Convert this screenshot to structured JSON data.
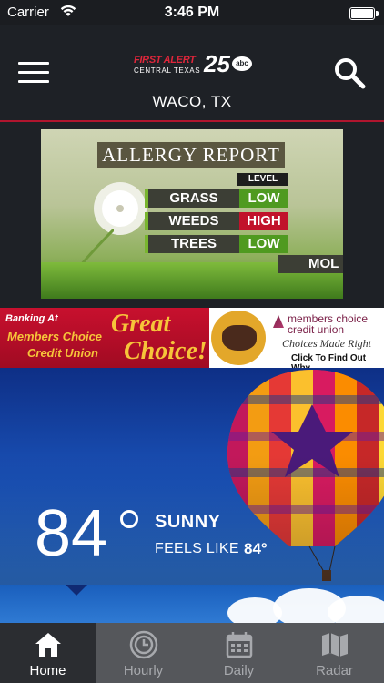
{
  "status_bar": {
    "carrier": "Carrier",
    "time": "3:46 PM"
  },
  "header": {
    "logo": {
      "line1": "FIRST ALERT",
      "line2": "CENTRAL TEXAS",
      "channel": "25",
      "network": "abc"
    },
    "location": "WACO, TX",
    "accent_color": "#b0152e"
  },
  "allergy_report": {
    "title": "ALLERGY REPORT",
    "level_header": "LEVEL",
    "rows": [
      {
        "name": "GRASS",
        "level": "LOW",
        "level_color": "#4f9a20"
      },
      {
        "name": "WEEDS",
        "level": "HIGH",
        "level_color": "#c1122b"
      },
      {
        "name": "TREES",
        "level": "LOW",
        "level_color": "#4f9a20"
      }
    ],
    "partial": "MOL"
  },
  "ad": {
    "line1": "Banking At",
    "line2": "Members Choice",
    "line3": "Credit Union",
    "headline1": "Great",
    "headline2": "Choice!",
    "brand": "members choice credit union",
    "brand_line1": "members choice",
    "brand_line2": "credit union",
    "tagline": "Choices Made Right",
    "cta": "Click To Find Out Why."
  },
  "weather": {
    "temperature": "84",
    "condition": "SUNNY",
    "feels_like_label": "FEELS LIKE",
    "feels_like_value": "84°"
  },
  "tabs": [
    {
      "label": "Home",
      "icon": "home-icon",
      "active": true
    },
    {
      "label": "Hourly",
      "icon": "clock-icon",
      "active": false
    },
    {
      "label": "Daily",
      "icon": "calendar-icon",
      "active": false
    },
    {
      "label": "Radar",
      "icon": "map-icon",
      "active": false
    }
  ]
}
